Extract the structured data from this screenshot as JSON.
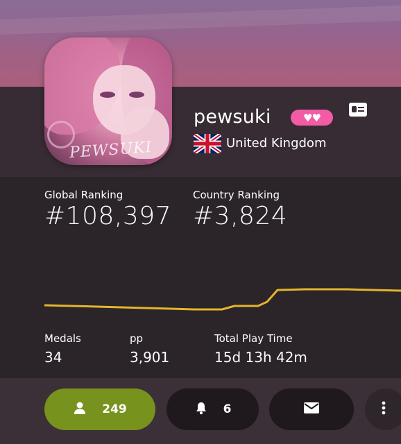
{
  "profile": {
    "username": "pewsuki",
    "supporter_badge": "♥♥",
    "country": "United Kingdom",
    "avatar_signature": "PEWSUKI"
  },
  "stats": {
    "global_ranking_label": "Global Ranking",
    "global_ranking_value": "#108,397",
    "country_ranking_label": "Country Ranking",
    "country_ranking_value": "#3,824",
    "medals_label": "Medals",
    "medals_value": "34",
    "pp_label": "pp",
    "pp_value": "3,901",
    "play_time_label": "Total Play Time",
    "play_time_value": "15d 13h 42m"
  },
  "rank_graph": {
    "color": "#e3b52d"
  },
  "actions": {
    "friends_count": "249",
    "notifications_count": "6"
  },
  "colors": {
    "supporter_pink": "#f25ca5",
    "friends_green": "#77921d",
    "header_bg": "#372c33",
    "body_bg": "#2b2429"
  },
  "icons": {
    "friends": "user-icon",
    "notifications": "bell-icon",
    "message": "envelope-icon",
    "more": "more-vertical-icon",
    "profile_card": "id-card-icon",
    "flag": "uk-flag-icon"
  }
}
